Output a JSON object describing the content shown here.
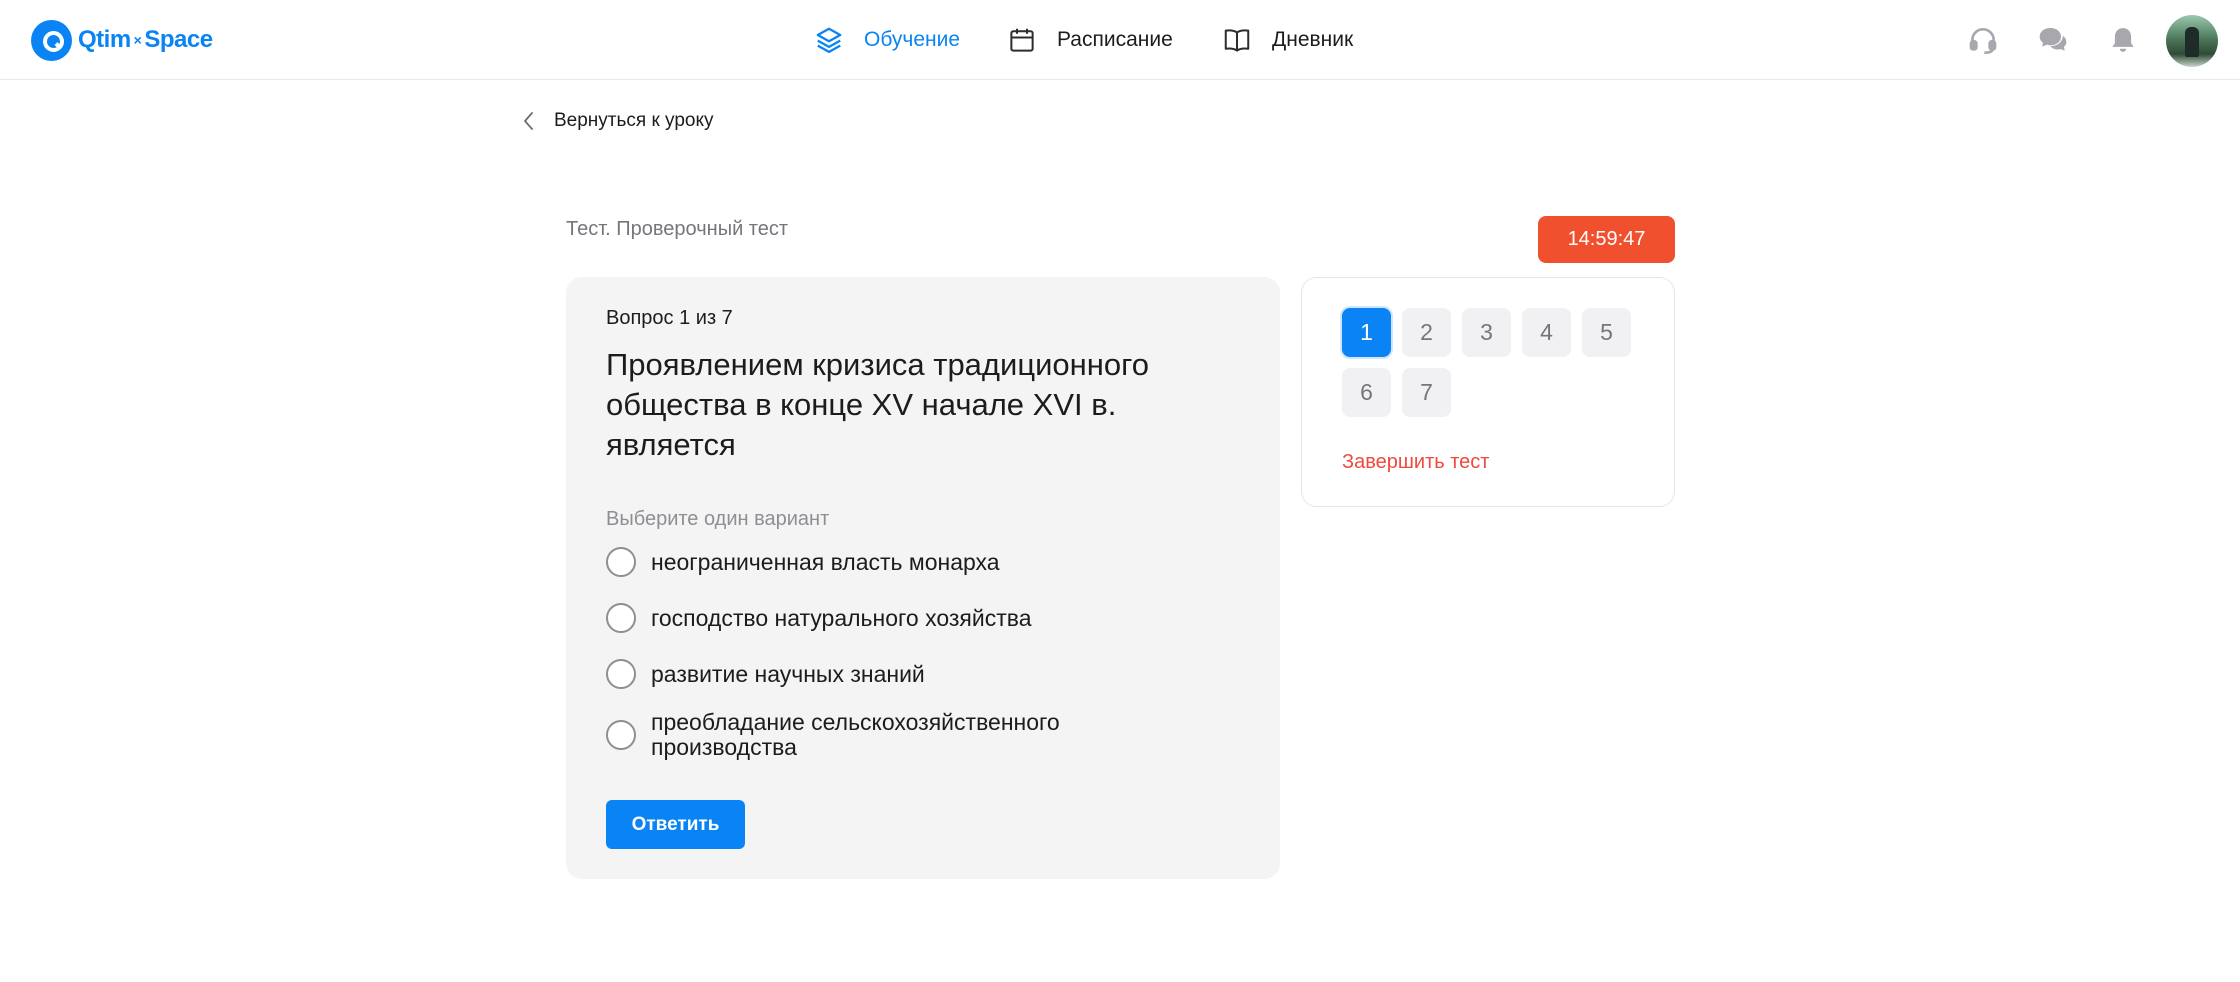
{
  "brand": {
    "left": "Qtim",
    "sep": "×",
    "right": "Space"
  },
  "nav": [
    {
      "label": "Обучение",
      "icon": "layers-icon",
      "active": true
    },
    {
      "label": "Расписание",
      "icon": "calendar-icon",
      "active": false
    },
    {
      "label": "Дневник",
      "icon": "book-icon",
      "active": false
    }
  ],
  "header_icons": [
    "headset-icon",
    "chat-icon",
    "bell-icon"
  ],
  "back_label": "Вернуться к уроку",
  "test_title": "Тест. Проверочный тест",
  "timer": "14:59:47",
  "question": {
    "counter": "Вопрос 1 из 7",
    "text": "Проявлением кризиса традиционного общества в конце XV начале XVI в. является",
    "hint": "Выберите один вариант",
    "options": [
      "неограниченная власть монарха",
      "господство натурального хозяйства",
      "развитие научных знаний",
      "преобладание сельскохозяйственного производства"
    ],
    "submit_label": "Ответить"
  },
  "navigator": {
    "numbers": [
      "1",
      "2",
      "3",
      "4",
      "5",
      "6",
      "7"
    ],
    "current": "1",
    "finish_label": "Завершить тест"
  },
  "colors": {
    "accent": "#0a84f4",
    "timer": "#f0502e",
    "danger": "#ef4a3c"
  }
}
